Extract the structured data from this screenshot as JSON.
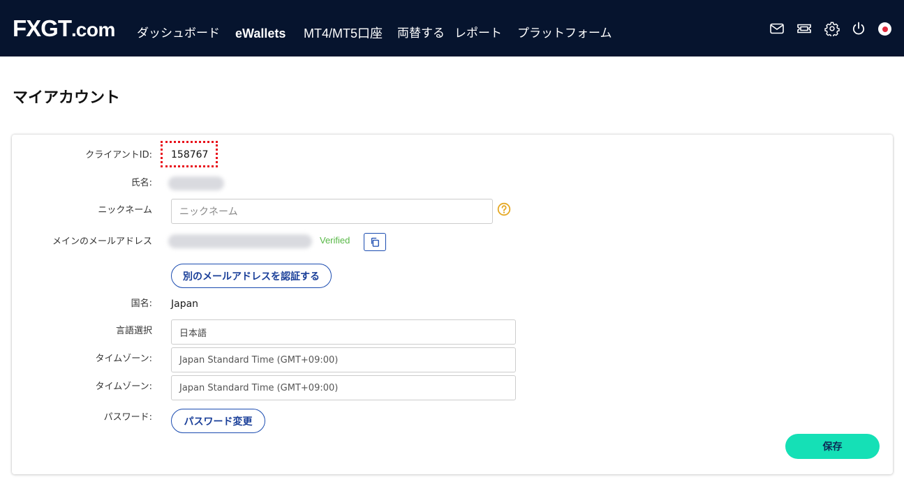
{
  "header": {
    "logo": {
      "fx": "FX",
      "g": "G",
      "t": "T",
      "dot": ".",
      "tld": "com"
    },
    "nav": [
      {
        "label": "ダッシュボード"
      },
      {
        "label": "eWallets"
      },
      {
        "label": "MT4/MT5口座"
      },
      {
        "label": "両替する"
      },
      {
        "label": "レポート"
      },
      {
        "label": "プラットフォーム"
      }
    ],
    "icons": [
      "mail-icon",
      "ticket-icon",
      "gear-icon",
      "power-icon",
      "japan-flag-icon"
    ]
  },
  "page": {
    "title": "マイアカウント"
  },
  "form": {
    "client_id": {
      "label": "クライアントID:",
      "value": "158767"
    },
    "full_name": {
      "label": "氏名:"
    },
    "nickname": {
      "label": "ニックネーム",
      "placeholder": "ニックネーム"
    },
    "main_email": {
      "label": "メインのメールアドレス",
      "status": "Verified"
    },
    "verify_other_email_button": "別のメールアドレスを認証する",
    "country": {
      "label": "国名:",
      "value": "Japan"
    },
    "language": {
      "label": "言語選択",
      "value": "日本語"
    },
    "timezone_1": {
      "label": "タイムゾーン:",
      "value": "Japan Standard Time (GMT+09:00)"
    },
    "timezone_2": {
      "label": "タイムゾーン:",
      "value": "Japan Standard Time (GMT+09:00)"
    },
    "password": {
      "label": "パスワード:",
      "button": "パスワード変更"
    },
    "save_button": "保存"
  },
  "colors": {
    "header_bg": "#06142e",
    "accent_button": "#15e0b6",
    "link_blue": "#1a3f99",
    "verified_green": "#57b846",
    "highlight_red": "#e8101a",
    "help_icon": "#e5a823"
  }
}
